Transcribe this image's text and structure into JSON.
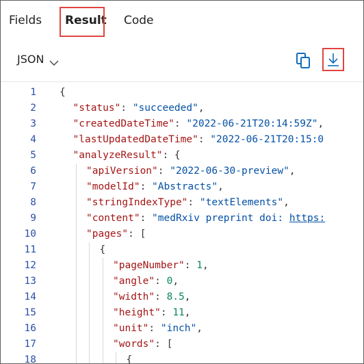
{
  "tabs": [
    {
      "label": "Fields"
    },
    {
      "label": "Result",
      "selected": true
    },
    {
      "label": "Code"
    }
  ],
  "toolbar": {
    "format_label": "JSON",
    "format_icon": "chevron-down-icon",
    "copy_icon": "copy-icon",
    "download_icon": "download-icon"
  },
  "colors": {
    "highlight": "#e0443f",
    "line_number": "#2a4ea8",
    "key": "#a31515",
    "string": "#0451a5",
    "number": "#098658",
    "icon_blue": "#0f6cbd"
  },
  "code": {
    "lines": [
      {
        "no": "1",
        "indent": 0,
        "tokens": [
          {
            "t": "p",
            "v": "{"
          }
        ]
      },
      {
        "no": "2",
        "indent": 1,
        "tokens": [
          {
            "t": "k",
            "v": "\"status\""
          },
          {
            "t": "p",
            "v": ": "
          },
          {
            "t": "s",
            "v": "\"succeeded\""
          },
          {
            "t": "p",
            "v": ","
          }
        ]
      },
      {
        "no": "3",
        "indent": 1,
        "tokens": [
          {
            "t": "k",
            "v": "\"createdDateTime\""
          },
          {
            "t": "p",
            "v": ": "
          },
          {
            "t": "s",
            "v": "\"2022-06-21T20:14:59Z\""
          },
          {
            "t": "p",
            "v": ","
          }
        ]
      },
      {
        "no": "4",
        "indent": 1,
        "tokens": [
          {
            "t": "k",
            "v": "\"lastUpdatedDateTime\""
          },
          {
            "t": "p",
            "v": ": "
          },
          {
            "t": "s",
            "v": "\"2022-06-21T20:15:0"
          }
        ]
      },
      {
        "no": "5",
        "indent": 1,
        "tokens": [
          {
            "t": "k",
            "v": "\"analyzeResult\""
          },
          {
            "t": "p",
            "v": ": {"
          }
        ]
      },
      {
        "no": "6",
        "indent": 2,
        "tokens": [
          {
            "t": "k",
            "v": "\"apiVersion\""
          },
          {
            "t": "p",
            "v": ": "
          },
          {
            "t": "s",
            "v": "\"2022-06-30-preview\""
          },
          {
            "t": "p",
            "v": ","
          }
        ]
      },
      {
        "no": "7",
        "indent": 2,
        "tokens": [
          {
            "t": "k",
            "v": "\"modelId\""
          },
          {
            "t": "p",
            "v": ": "
          },
          {
            "t": "s",
            "v": "\"Abstracts\""
          },
          {
            "t": "p",
            "v": ","
          }
        ]
      },
      {
        "no": "8",
        "indent": 2,
        "tokens": [
          {
            "t": "k",
            "v": "\"stringIndexType\""
          },
          {
            "t": "p",
            "v": ": "
          },
          {
            "t": "s",
            "v": "\"textElements\""
          },
          {
            "t": "p",
            "v": ","
          }
        ]
      },
      {
        "no": "9",
        "indent": 2,
        "tokens": [
          {
            "t": "k",
            "v": "\"content\""
          },
          {
            "t": "p",
            "v": ": "
          },
          {
            "t": "s",
            "v": "\"medRxiv preprint doi: "
          },
          {
            "t": "su",
            "v": "https:"
          }
        ]
      },
      {
        "no": "10",
        "indent": 2,
        "tokens": [
          {
            "t": "k",
            "v": "\"pages\""
          },
          {
            "t": "p",
            "v": ": ["
          }
        ]
      },
      {
        "no": "11",
        "indent": 3,
        "tokens": [
          {
            "t": "p",
            "v": "{"
          }
        ]
      },
      {
        "no": "12",
        "indent": 4,
        "tokens": [
          {
            "t": "k",
            "v": "\"pageNumber\""
          },
          {
            "t": "p",
            "v": ": "
          },
          {
            "t": "n",
            "v": "1"
          },
          {
            "t": "p",
            "v": ","
          }
        ]
      },
      {
        "no": "13",
        "indent": 4,
        "tokens": [
          {
            "t": "k",
            "v": "\"angle\""
          },
          {
            "t": "p",
            "v": ": "
          },
          {
            "t": "n",
            "v": "0"
          },
          {
            "t": "p",
            "v": ","
          }
        ]
      },
      {
        "no": "14",
        "indent": 4,
        "tokens": [
          {
            "t": "k",
            "v": "\"width\""
          },
          {
            "t": "p",
            "v": ": "
          },
          {
            "t": "n",
            "v": "8.5"
          },
          {
            "t": "p",
            "v": ","
          }
        ]
      },
      {
        "no": "15",
        "indent": 4,
        "tokens": [
          {
            "t": "k",
            "v": "\"height\""
          },
          {
            "t": "p",
            "v": ": "
          },
          {
            "t": "n",
            "v": "11"
          },
          {
            "t": "p",
            "v": ","
          }
        ]
      },
      {
        "no": "16",
        "indent": 4,
        "tokens": [
          {
            "t": "k",
            "v": "\"unit\""
          },
          {
            "t": "p",
            "v": ": "
          },
          {
            "t": "s",
            "v": "\"inch\""
          },
          {
            "t": "p",
            "v": ","
          }
        ]
      },
      {
        "no": "17",
        "indent": 4,
        "tokens": [
          {
            "t": "k",
            "v": "\"words\""
          },
          {
            "t": "p",
            "v": ": ["
          }
        ]
      },
      {
        "no": "18",
        "indent": 5,
        "tokens": [
          {
            "t": "p",
            "v": "{"
          }
        ]
      }
    ]
  }
}
